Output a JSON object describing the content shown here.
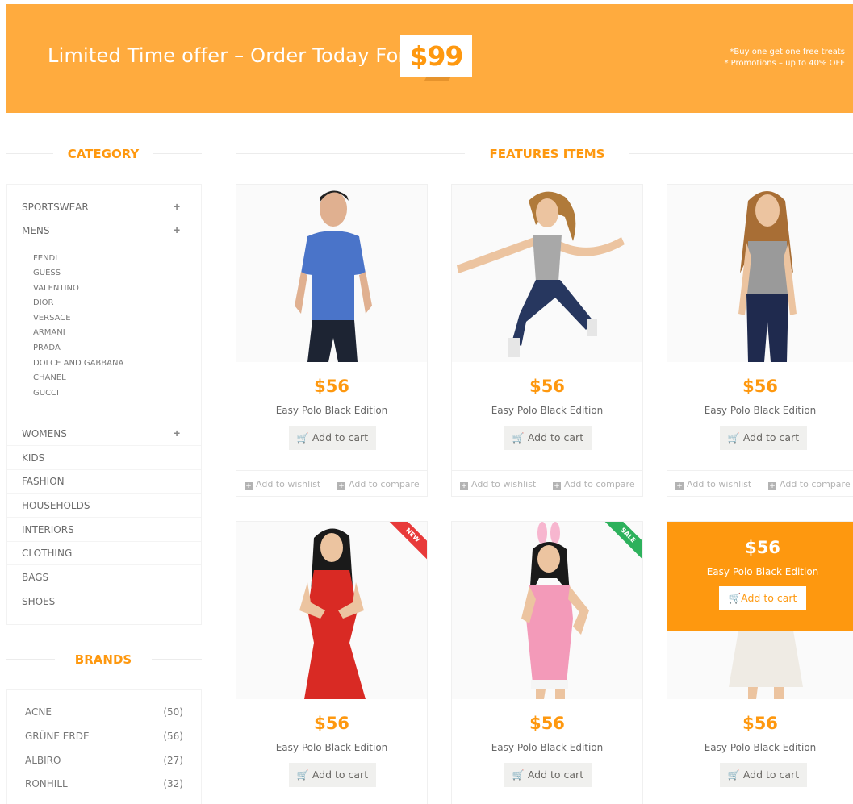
{
  "banner": {
    "title": "Limited Time offer – Order Today For",
    "price": "$99",
    "promo_1": "*Buy one get one free treats",
    "promo_2": "* Promotions – up to 40% OFF",
    "color": "#FFAB3E"
  },
  "sidebar": {
    "category_title": "CATEGORY",
    "categories_top": [
      {
        "label": "SPORTSWEAR",
        "expandable": true
      },
      {
        "label": "MENS",
        "expandable": true
      }
    ],
    "mens_subitems": [
      "FENDI",
      "GUESS",
      "VALENTINO",
      "DIOR",
      "VERSACE",
      "ARMANI",
      "PRADA",
      "DOLCE AND GABBANA",
      "CHANEL",
      "GUCCI"
    ],
    "categories_bottom": [
      {
        "label": "WOMENS",
        "expandable": true
      },
      {
        "label": "KIDS",
        "expandable": false
      },
      {
        "label": "FASHION",
        "expandable": false
      },
      {
        "label": "HOUSEHOLDS",
        "expandable": false
      },
      {
        "label": "INTERIORS",
        "expandable": false
      },
      {
        "label": "CLOTHING",
        "expandable": false
      },
      {
        "label": "BAGS",
        "expandable": false
      },
      {
        "label": "SHOES",
        "expandable": false
      }
    ],
    "plus_glyph": "+",
    "brands_title": "BRANDS",
    "brands": [
      {
        "name": "ACNE",
        "count": "(50)"
      },
      {
        "name": "GRÜNE ERDE",
        "count": "(56)"
      },
      {
        "name": "ALBIRO",
        "count": "(27)"
      },
      {
        "name": "RONHILL",
        "count": "(32)"
      }
    ]
  },
  "features": {
    "title": "FEATURES ITEMS",
    "cart_label": "Add to cart",
    "wishlist_label": "Add to wishlist",
    "compare_label": "Add to compare",
    "products": [
      {
        "price": "$56",
        "name": "Easy Polo Black Edition",
        "badge": ""
      },
      {
        "price": "$56",
        "name": "Easy Polo Black Edition",
        "badge": ""
      },
      {
        "price": "$56",
        "name": "Easy Polo Black Edition",
        "badge": ""
      },
      {
        "price": "$56",
        "name": "Easy Polo Black Edition",
        "badge": "NEW"
      },
      {
        "price": "$56",
        "name": "Easy Polo Black Edition",
        "badge": "SALE"
      },
      {
        "price": "$56",
        "name": "Easy Polo Black Edition",
        "badge": ""
      }
    ],
    "overlay": {
      "price": "$56",
      "name": "Easy Polo Black Edition",
      "cart_label": "Add to cart"
    }
  },
  "colors": {
    "accent": "#FE980F",
    "new_badge": "#E83A3A",
    "sale_badge": "#2DB15C"
  }
}
